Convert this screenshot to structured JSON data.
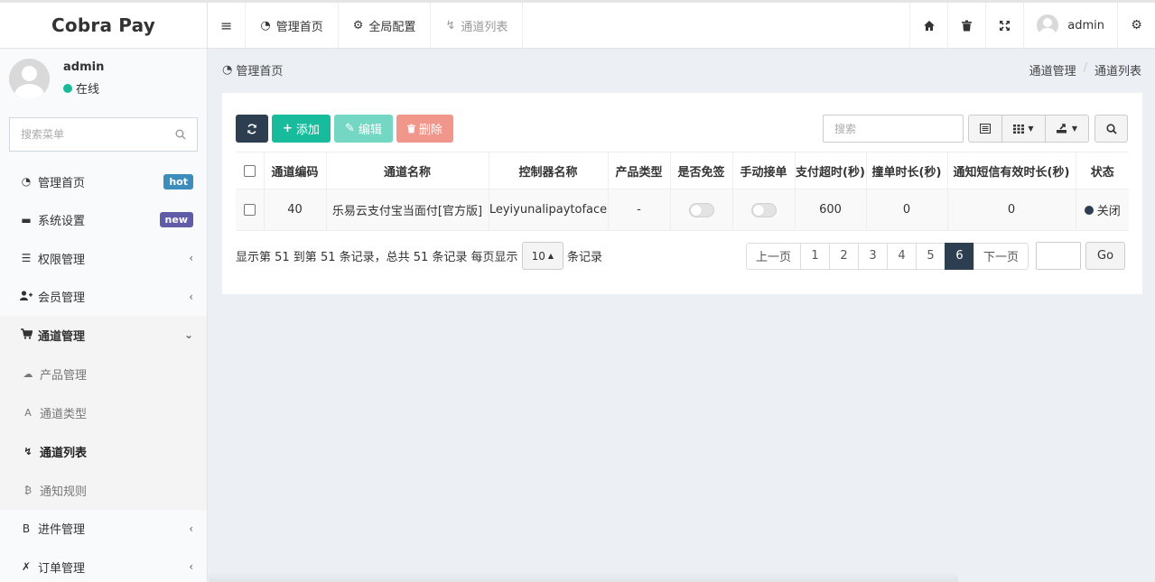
{
  "brand": "Cobra Pay",
  "header": {
    "tabs": [
      {
        "icon": "≡",
        "label": ""
      },
      {
        "icon": "◔",
        "label": "管理首页"
      },
      {
        "icon": "⚙",
        "label": "全局配置"
      },
      {
        "icon": "↯",
        "label": "通道列表"
      }
    ],
    "right_icons": [
      "home-icon",
      "trash-icon",
      "fullscreen-icon"
    ],
    "user": "admin"
  },
  "sidebar": {
    "user": {
      "name": "admin",
      "status": "在线"
    },
    "search_placeholder": "搜索菜单",
    "menu": [
      {
        "icon": "◔",
        "label": "管理首页",
        "badge": "hot",
        "badge_color": "#3c8dbc"
      },
      {
        "icon": "▬",
        "label": "系统设置",
        "badge": "new",
        "badge_color": "#605ca8"
      },
      {
        "icon": "☰",
        "label": "权限管理",
        "chevron": "‹"
      },
      {
        "icon": "👥",
        "label": "会员管理",
        "chevron": "‹"
      },
      {
        "icon": "🛒",
        "label": "通道管理",
        "chevron": "⌄"
      }
    ],
    "submenu": [
      {
        "icon": "☁",
        "label": "产品管理"
      },
      {
        "icon": "A",
        "label": "通道类型"
      },
      {
        "icon": "↯",
        "label": "通道列表"
      },
      {
        "icon": "₿",
        "label": "通知规则"
      }
    ],
    "menu_bottom": [
      {
        "icon": "B",
        "label": "进件管理",
        "chevron": "‹"
      },
      {
        "icon": "✗",
        "label": "订单管理",
        "chevron": "‹"
      }
    ]
  },
  "content": {
    "page_title": "管理首页",
    "breadcrumb": [
      "通道管理",
      "通道列表"
    ],
    "toolbar": {
      "add": "添加",
      "edit": "编辑",
      "delete": "删除"
    },
    "search_placeholder": "搜索",
    "columns": [
      "通道编码",
      "通道名称",
      "控制器名称",
      "产品类型",
      "是否免签",
      "手动接单",
      "支付超时(秒)",
      "撞单时长(秒)",
      "通知短信有效时长(秒)",
      "状态"
    ],
    "rows": [
      {
        "code": "40",
        "name": "乐易云支付宝当面付[官方版]",
        "controller": "Leyiyunalipaytoface",
        "product_type": "-",
        "free_sign": false,
        "manual": false,
        "timeout": "600",
        "collision": "0",
        "sms_valid": "0",
        "status": "关闭"
      }
    ],
    "pagination": {
      "info_prefix": "显示第 51 到第 51 条记录，总共 51 条记录 每页显示",
      "page_size": "10",
      "info_suffix": "条记录",
      "prev": "上一页",
      "pages": [
        "1",
        "2",
        "3",
        "4",
        "5",
        "6"
      ],
      "current": "6",
      "next": "下一页",
      "go": "Go"
    }
  },
  "colors": {
    "primary": "#2c3e50",
    "success": "#18bc9c",
    "danger": "#e74c3c"
  }
}
